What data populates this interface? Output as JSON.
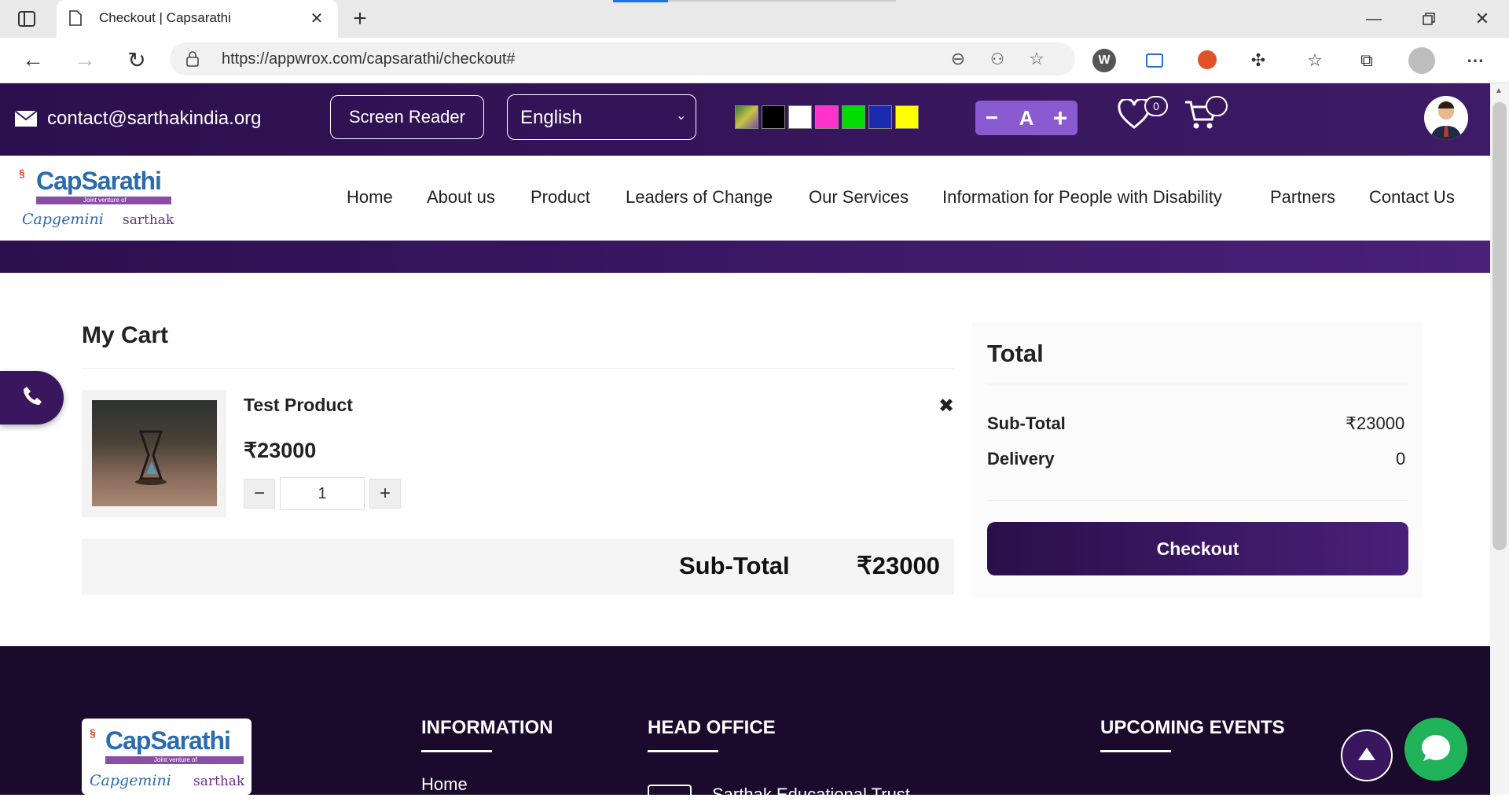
{
  "browser": {
    "tab_title": "Checkout | Capsarathi",
    "url": "https://appwrox.com/capsarathi/checkout#"
  },
  "topbar": {
    "email": "contact@sarthakindia.org",
    "screen_reader": "Screen Reader",
    "language": "English",
    "swatch_colors": [
      "#8a8a3a",
      "#000000",
      "#ffffff",
      "#ff33cc",
      "#00dd00",
      "#1a2bb0",
      "#ffff00"
    ],
    "font_minus": "−",
    "font_a": "A",
    "font_plus": "+",
    "wishlist_count": "0"
  },
  "logo": {
    "brand": "CapSarathi",
    "tagline": "Joint venture of",
    "partner1": "Capgemini",
    "partner2": "sarthak"
  },
  "nav": [
    "Home",
    "About us",
    "Product",
    "Leaders of Change",
    "Our Services",
    "Information for People with Disability",
    "Partners",
    "Contact Us"
  ],
  "cart": {
    "title": "My Cart",
    "item_name": "Test Product",
    "item_price": "₹23000",
    "quantity": "1",
    "minus": "−",
    "plus": "+",
    "remove": "✖",
    "subtotal_label": "Sub-Total",
    "subtotal_value": "₹23000"
  },
  "total": {
    "title": "Total",
    "subtotal_label": "Sub-Total",
    "subtotal_value": "₹23000",
    "delivery_label": "Delivery",
    "delivery_value": "0",
    "checkout": "Checkout"
  },
  "footer": {
    "info_heading": "INFORMATION",
    "info_first_link": "Home",
    "office_heading": "HEAD OFFICE",
    "office_name": "Sarthak Educational Trust",
    "events_heading": "UPCOMING EVENTS"
  },
  "colors": {
    "brand_purple": "#3a165f",
    "chat_green": "#21b35a"
  }
}
